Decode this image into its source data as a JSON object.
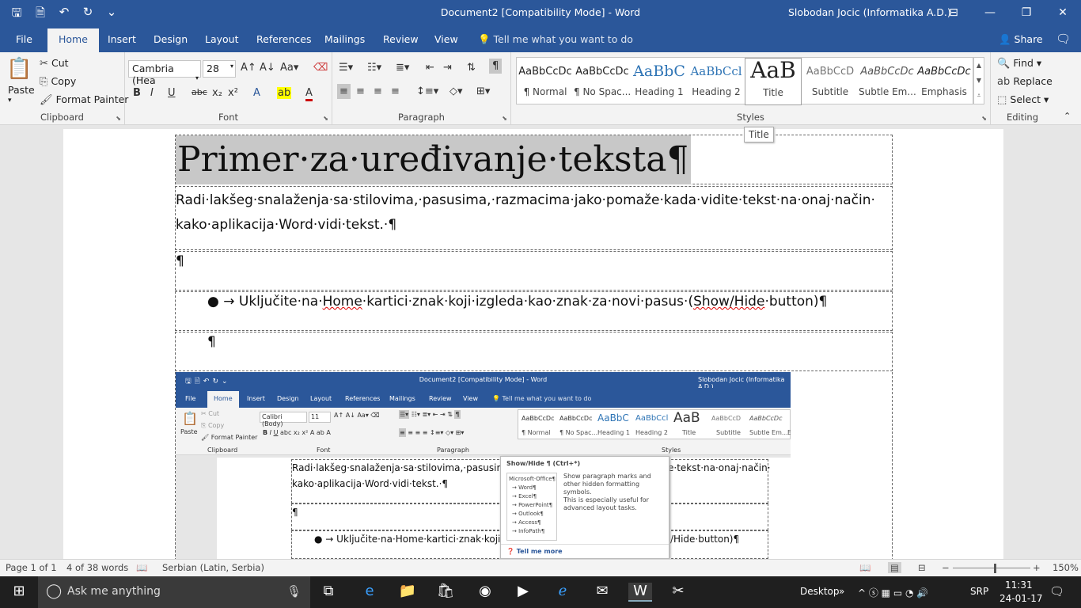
{
  "window": {
    "title": "Document2 [Compatibility Mode]  -  Word",
    "user": "Slobodan Jocic (Informatika A.D.)",
    "accent": "#2b579a"
  },
  "qat_icons": [
    "save-icon",
    "save-as-icon",
    "undo-icon",
    "redo-icon",
    "customize-icon"
  ],
  "tabs": [
    "File",
    "Home",
    "Insert",
    "Design",
    "Layout",
    "References",
    "Mailings",
    "Review",
    "View"
  ],
  "active_tab": "Home",
  "tell_me": "Tell me what you want to do",
  "share": "Share",
  "clipboard": {
    "paste": "Paste",
    "cut": "Cut",
    "copy": "Copy",
    "format_painter": "Format Painter",
    "label": "Clipboard"
  },
  "font": {
    "name": "Cambria (Hea",
    "size": "28",
    "label": "Font"
  },
  "paragraph": {
    "label": "Paragraph"
  },
  "styles": {
    "label": "Styles",
    "items": [
      {
        "preview": "AaBbCcDc",
        "name": "¶ Normal"
      },
      {
        "preview": "AaBbCcDc",
        "name": "¶ No Spac..."
      },
      {
        "preview": "AaBbC",
        "name": "Heading 1"
      },
      {
        "preview": "AaBbCcl",
        "name": "Heading 2"
      },
      {
        "preview": "AaB",
        "name": "Title"
      },
      {
        "preview": "AaBbCcD",
        "name": "Subtitle"
      },
      {
        "preview": "AaBbCcDc",
        "name": "Subtle Em..."
      },
      {
        "preview": "AaBbCcDc",
        "name": "Emphasis"
      }
    ],
    "selected": "Title",
    "tooltip": "Title"
  },
  "editing": {
    "find": "Find",
    "replace": "Replace",
    "select": "Select",
    "label": "Editing"
  },
  "document": {
    "title": "Primer·za·uređivanje·teksta¶",
    "line1": "Radi·lakšeg·snalaženja·sa·stilovima,·pasusima,·razmacima·jako·pomaže·kada·vidite·tekst·na·onaj·način·",
    "line2": "kako·aplikacija·Word·vidi·tekst.·¶",
    "empty_mark": "¶",
    "bullet_pre": "Uključite·na·",
    "bullet_home": "Home",
    "bullet_mid": "·kartici·znak·koji·izgleda·kao·znak·za·novi·pasus·(",
    "bullet_show": "Show/Hide",
    "bullet_post": "·button)¶"
  },
  "embedded": {
    "title": "Document2 [Compatibility Mode]  -  Word",
    "user": "Slobodan Jocic (Informatika A.D.)",
    "tabs": [
      "File",
      "Home",
      "Insert",
      "Design",
      "Layout",
      "References",
      "Mailings",
      "Review",
      "View"
    ],
    "tell_me": "Tell me what you want to do",
    "cut": "Cut",
    "copy": "Copy",
    "format_painter": "Format Painter",
    "paste": "Paste",
    "font_name": "Calibri (Body)",
    "font_size": "11",
    "groups": [
      "Clipboard",
      "Font",
      "Paragraph",
      "Styles"
    ],
    "styles": [
      "¶ Normal",
      "¶ No Spac...",
      "Heading 1",
      "Heading 2",
      "Title",
      "Subtitle",
      "Subtle Em...",
      "E"
    ],
    "style_previews": [
      "AaBbCcDc",
      "AaBbCcDc",
      "AaBbC",
      "AaBbCcl",
      "AaB",
      "AaBbCcD",
      "AaBbCcDc",
      ""
    ],
    "line1_a": "Radi·lakšeg·snalaženja·sa·stilovima,·pasusima",
    "line1_b": "e·tekst·na·onaj·način·",
    "line2": "kako·aplikacija·Word·vidi·tekst.·¶",
    "empty_mark": "¶",
    "bullet_a": "Uključite·na·Home·kartici·znak·koji·iz",
    "bullet_b": "/Hide·button)¶",
    "tip": {
      "title": "Show/Hide ¶ (Ctrl+*)",
      "desc1": "Show paragraph marks and other hidden formatting symbols.",
      "desc2": "This is especially useful for advanced layout tasks.",
      "list": [
        "Microsoft·Office¶",
        "→ Word¶",
        "→ Excel¶",
        "→ PowerPoint¶",
        "→ Outlook¶",
        "→ Access¶",
        "→ InfoPath¶"
      ],
      "more": "Tell me more"
    }
  },
  "status": {
    "page": "Page 1 of 1",
    "words": "4 of 38 words",
    "language": "Serbian (Latin, Serbia)",
    "zoom": "150%"
  },
  "taskbar": {
    "search": "Ask me anything",
    "desktop": "Desktop",
    "lang": "SRP",
    "time": "11:31",
    "date": "24-01-17"
  }
}
